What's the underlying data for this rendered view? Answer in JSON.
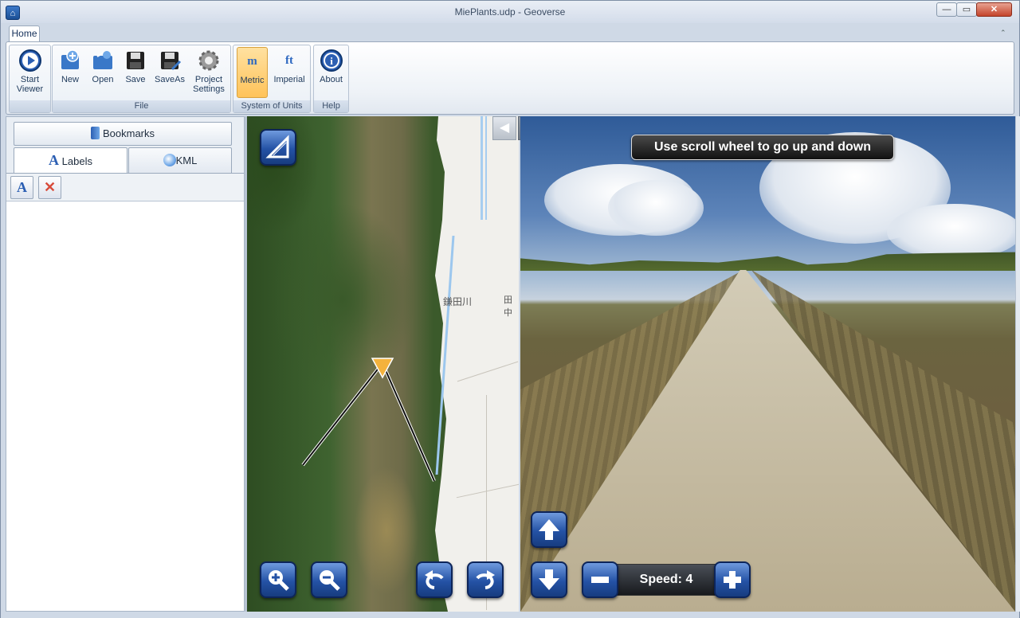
{
  "window": {
    "title": "MiePlants.udp - Geoverse",
    "minimize": "—",
    "maximize": "▭",
    "close": "✕"
  },
  "ribbon": {
    "tab_home": "Home",
    "collapse_glyph": "⌃",
    "start_viewer": {
      "label": "Start\nViewer",
      "line1": "Start",
      "line2": "Viewer",
      "icon": "play-icon"
    },
    "file_group": {
      "label": "File",
      "new": "New",
      "open": "Open",
      "save": "Save",
      "saveas": "SaveAs",
      "project_settings_line1": "Project",
      "project_settings_line2": "Settings"
    },
    "units_group": {
      "label": "System of Units",
      "metric": "Metric",
      "imperial": "Imperial",
      "metric_glyph": "m",
      "imperial_glyph": "ft"
    },
    "help_group": {
      "label": "Help",
      "about": "About",
      "about_glyph": "i"
    }
  },
  "left_panel": {
    "bookmarks": "Bookmarks",
    "tabs": [
      {
        "label": "Labels",
        "active": true
      },
      {
        "label": "KML",
        "active": false
      }
    ],
    "toolbar": {
      "add_label_glyph": "A",
      "delete_glyph": "✕"
    }
  },
  "map": {
    "place_name": "鎌田川",
    "place_name2": "田中",
    "pane_left": "◀",
    "pane_right": "▶"
  },
  "view3d": {
    "hint": "Use scroll wheel to go up and down",
    "speed_label": "Speed: 4"
  },
  "colors": {
    "accent": "#2452a5",
    "active_unit": "#ffc35a",
    "hint_bg": "#111111"
  }
}
